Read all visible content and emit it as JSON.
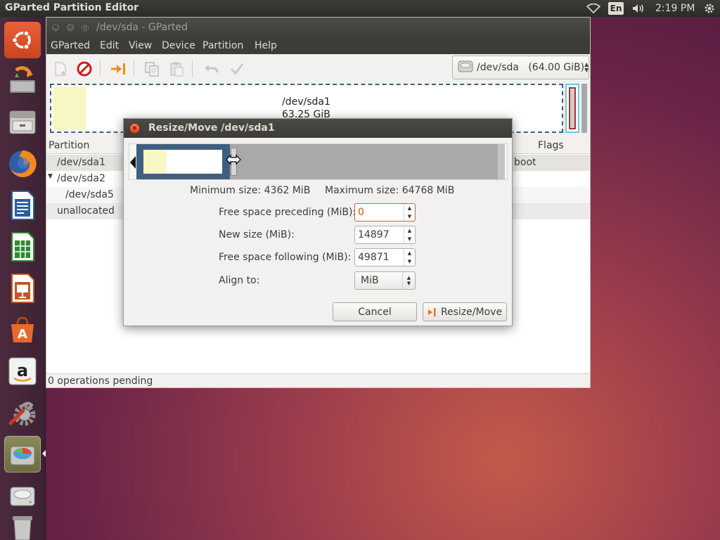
{
  "top_panel": {
    "app_title": "GParted Partition Editor",
    "keyboard_layout": "En",
    "clock": "2:19 PM",
    "icons": [
      "wifi-icon",
      "keyboard-layout-indicator",
      "volume-icon",
      "power-gear-icon"
    ]
  },
  "launcher": {
    "items": [
      {
        "name": "ubuntu-dash"
      },
      {
        "name": "software-updater"
      },
      {
        "name": "files"
      },
      {
        "name": "firefox"
      },
      {
        "name": "libreoffice-writer"
      },
      {
        "name": "libreoffice-calc"
      },
      {
        "name": "libreoffice-impress"
      },
      {
        "name": "ubuntu-software-center"
      },
      {
        "name": "amazon"
      },
      {
        "name": "system-settings"
      },
      {
        "name": "gparted",
        "active": true
      },
      {
        "name": "disk-drive"
      },
      {
        "name": "trash"
      }
    ]
  },
  "window": {
    "title": "/dev/sda - GParted",
    "menu": [
      "GParted",
      "Edit",
      "View",
      "Device",
      "Partition",
      "Help"
    ],
    "toolbar": [
      "new-partition-icon",
      "delete-icon",
      "resize-move-icon",
      "copy-icon",
      "paste-icon",
      "undo-icon",
      "apply-icon"
    ],
    "device_selector": "/dev/sda   (64.00 GiB)",
    "disk_graph": {
      "partition_name": "/dev/sda1",
      "partition_size": "63.25 GiB"
    },
    "columns": {
      "partition": "Partition",
      "flags": "Flags"
    },
    "rows": [
      {
        "partition": "/dev/sda1",
        "flags": "boot",
        "selected": true
      },
      {
        "partition": "/dev/sda2",
        "flags": "",
        "expanded": true
      },
      {
        "partition": "/dev/sda5",
        "flags": ""
      },
      {
        "partition": "unallocated",
        "flags": ""
      }
    ],
    "status": "0 operations pending"
  },
  "dialog": {
    "title": "Resize/Move /dev/sda1",
    "min_size": "Minimum size: 4362 MiB",
    "max_size": "Maximum size: 64768 MiB",
    "fields": {
      "preceding_label": "Free space preceding (MiB):",
      "preceding_value": "0",
      "new_size_label": "New size (MiB):",
      "new_size_value": "14897",
      "following_label": "Free space following (MiB):",
      "following_value": "49871",
      "align_label": "Align to:",
      "align_value": "MiB"
    },
    "buttons": {
      "cancel": "Cancel",
      "resize_move": "Resize/Move"
    }
  },
  "colors": {
    "partition_border": "#3e5f7f",
    "used_space": "#f7f7c3",
    "unallocated": "#a9a9a9",
    "close_button": "#e0491e"
  }
}
